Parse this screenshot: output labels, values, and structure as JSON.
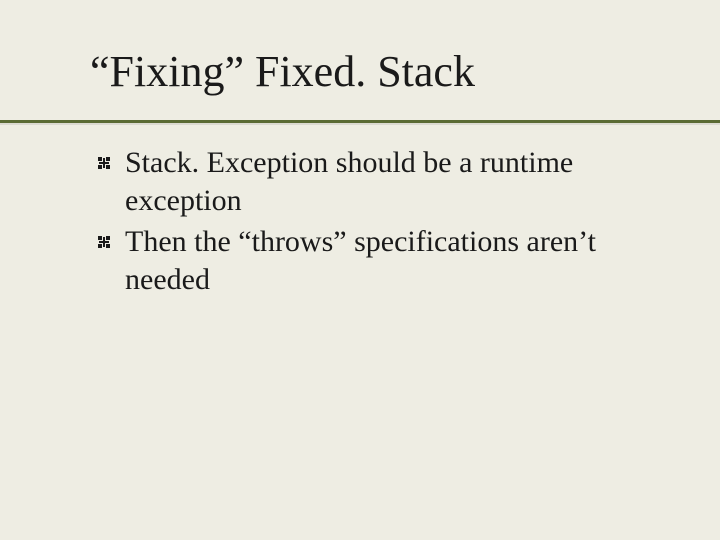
{
  "title": "“Fixing” Fixed. Stack",
  "bullets": [
    "Stack. Exception should be a runtime exception",
    "Then the “throws” specifications aren’t needed"
  ],
  "colors": {
    "background": "#eeede3",
    "rule": "#5a6b34",
    "text": "#1a1a1a"
  }
}
